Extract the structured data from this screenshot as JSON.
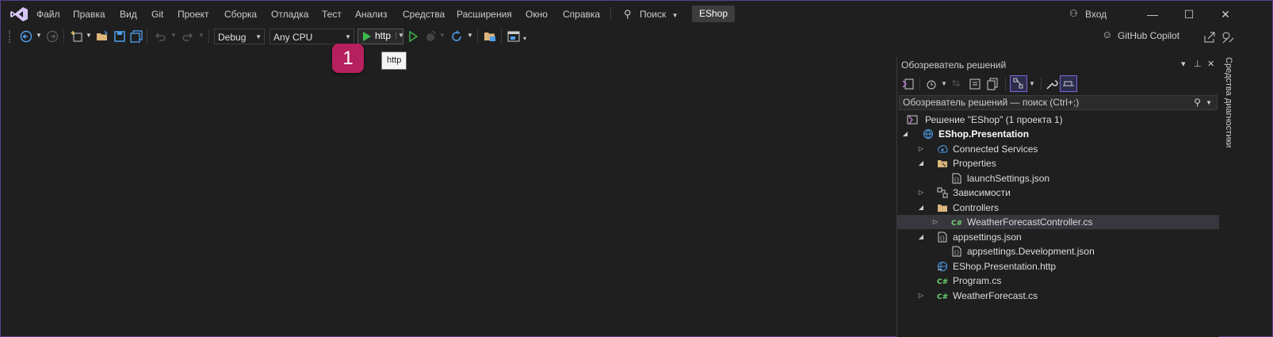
{
  "menu": {
    "items": [
      "Файл",
      "Правка",
      "Вид",
      "Git",
      "Проект",
      "Сборка",
      "Отладка",
      "Тест",
      "Анализ",
      "Средства",
      "Расширения",
      "Окно",
      "Справка"
    ],
    "search_label": "Поиск",
    "solution_name": "EShop",
    "signin_label": "Вход"
  },
  "toolbar": {
    "configuration": "Debug",
    "platform": "Any CPU",
    "run_target": "http",
    "copilot_label": "GitHub Copilot"
  },
  "callout": {
    "number": "1",
    "tooltip": "http"
  },
  "solution_explorer": {
    "title": "Обозреватель решений",
    "search_placeholder": "Обозреватель решений — поиск (Ctrl+;)",
    "tree": [
      {
        "label": "Решение \"EShop\"  (1 проекта 1)",
        "icon": "solution-icon",
        "expander": "",
        "bold": false,
        "selected": false
      },
      {
        "label": "EShop.Presentation",
        "icon": "web-project-icon",
        "expander": "open",
        "bold": true,
        "selected": false
      },
      {
        "label": "Connected Services",
        "icon": "connected-services-icon",
        "expander": "closed",
        "bold": false,
        "selected": false
      },
      {
        "label": "Properties",
        "icon": "properties-folder-icon",
        "expander": "open",
        "bold": false,
        "selected": false
      },
      {
        "label": "launchSettings.json",
        "icon": "json-file-icon",
        "expander": "",
        "bold": false,
        "selected": false
      },
      {
        "label": "Зависимости",
        "icon": "dependencies-icon",
        "expander": "closed",
        "bold": false,
        "selected": false
      },
      {
        "label": "Controllers",
        "icon": "folder-icon",
        "expander": "open",
        "bold": false,
        "selected": false
      },
      {
        "label": "WeatherForecastController.cs",
        "icon": "csharp-file-icon",
        "expander": "closed",
        "bold": false,
        "selected": true
      },
      {
        "label": "appsettings.json",
        "icon": "json-file-icon",
        "expander": "open",
        "bold": false,
        "selected": false
      },
      {
        "label": "appsettings.Development.json",
        "icon": "json-file-icon",
        "expander": "",
        "bold": false,
        "selected": false
      },
      {
        "label": "EShop.Presentation.http",
        "icon": "http-file-icon",
        "expander": "",
        "bold": false,
        "selected": false
      },
      {
        "label": "Program.cs",
        "icon": "csharp-file-icon",
        "expander": "",
        "bold": false,
        "selected": false
      },
      {
        "label": "WeatherForecast.cs",
        "icon": "csharp-file-icon",
        "expander": "closed",
        "bold": false,
        "selected": false
      }
    ]
  },
  "side_tab": {
    "label": "Средства диагностики"
  },
  "colors": {
    "accent": "#b5205f",
    "frame": "#5a3e8a",
    "run_green": "#3fb950",
    "csharp_green": "#6fd06f"
  }
}
